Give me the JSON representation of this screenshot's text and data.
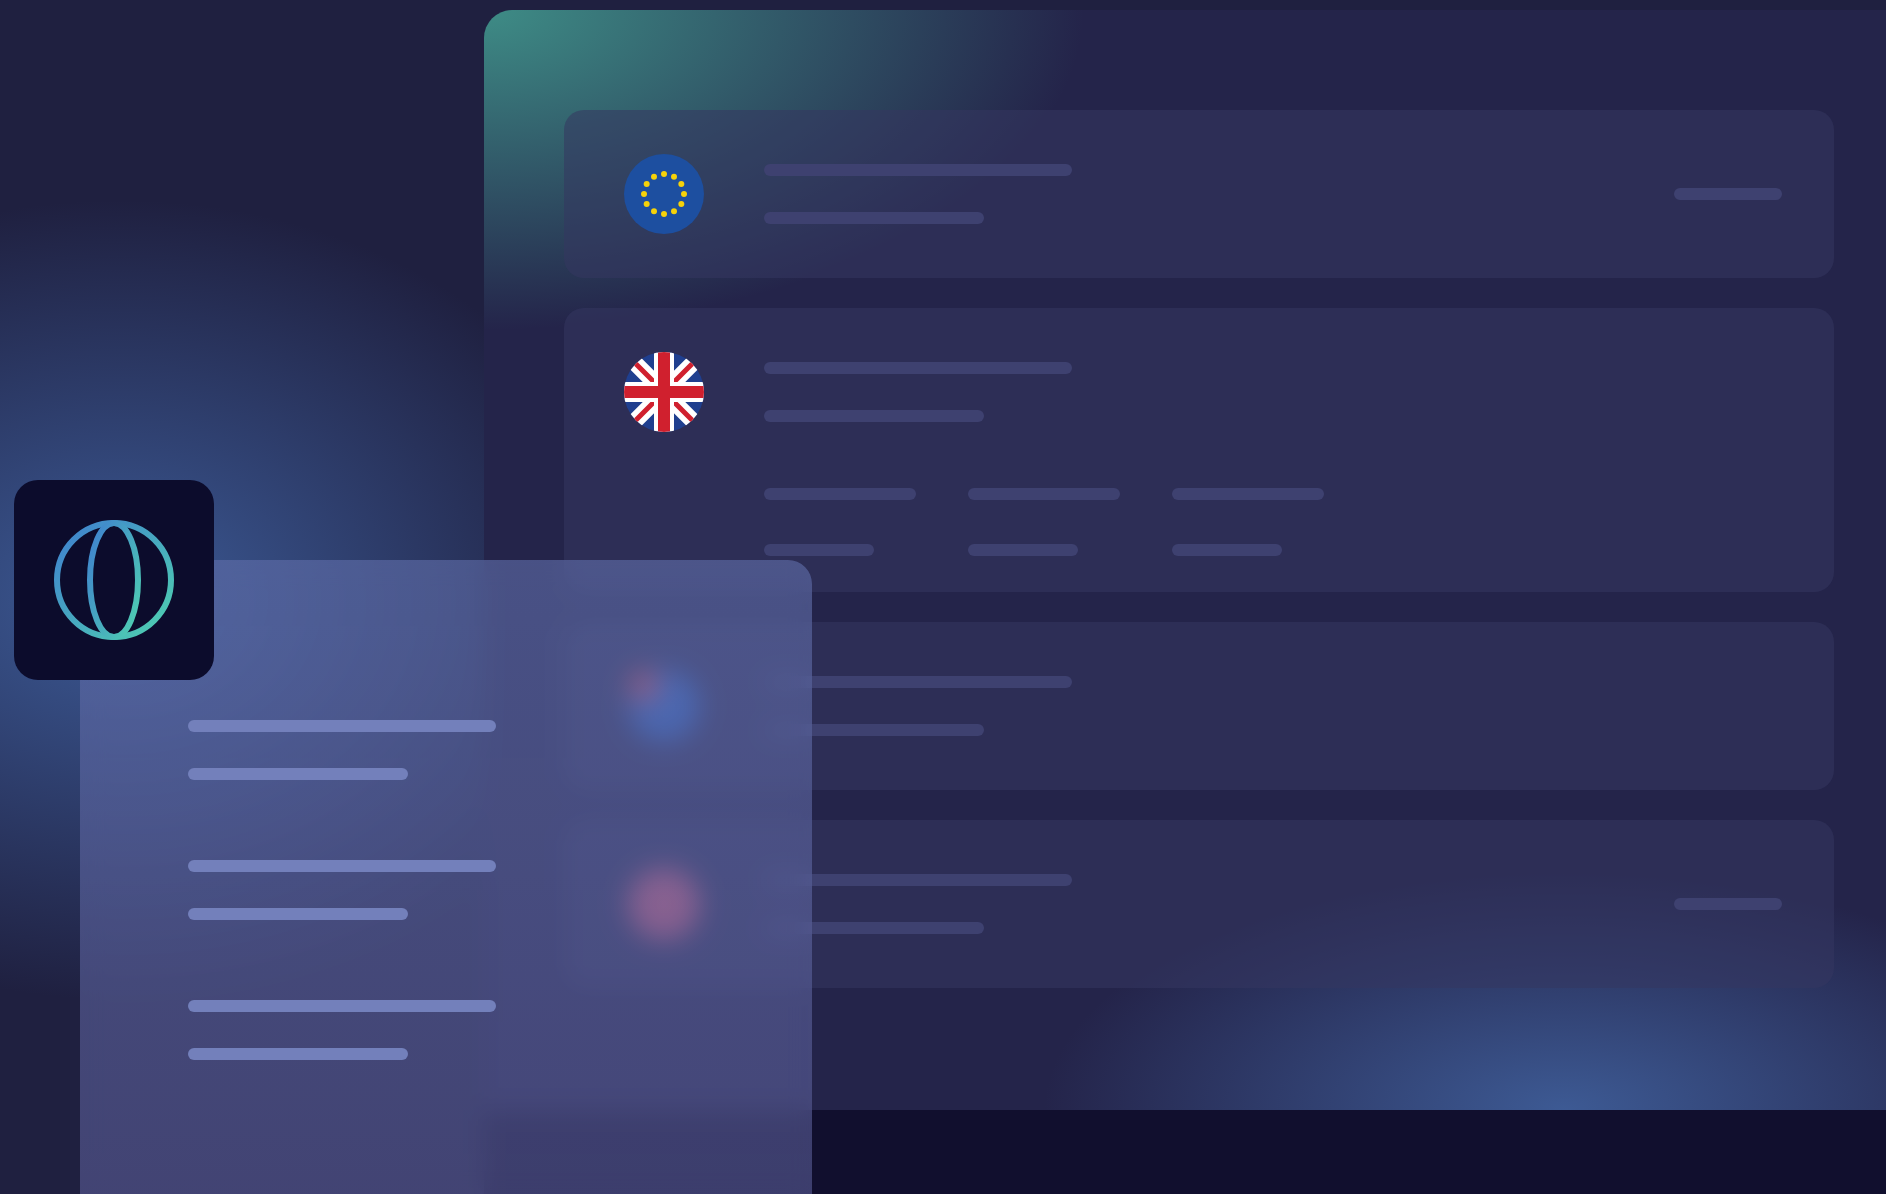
{
  "app_icon": {
    "kind": "globe"
  },
  "cards": [
    {
      "kind": "eu",
      "detail_rows": false,
      "trailing_line": true
    },
    {
      "kind": "uk",
      "detail_rows": true,
      "trailing_line": false
    },
    {
      "kind": "blue",
      "detail_rows": false,
      "trailing_line": false
    },
    {
      "kind": "red",
      "detail_rows": false,
      "trailing_line": true
    }
  ],
  "overlay_panel": {
    "groups": [
      {
        "kind": "skeleton"
      },
      {
        "kind": "skeleton"
      },
      {
        "kind": "skeleton"
      }
    ]
  }
}
